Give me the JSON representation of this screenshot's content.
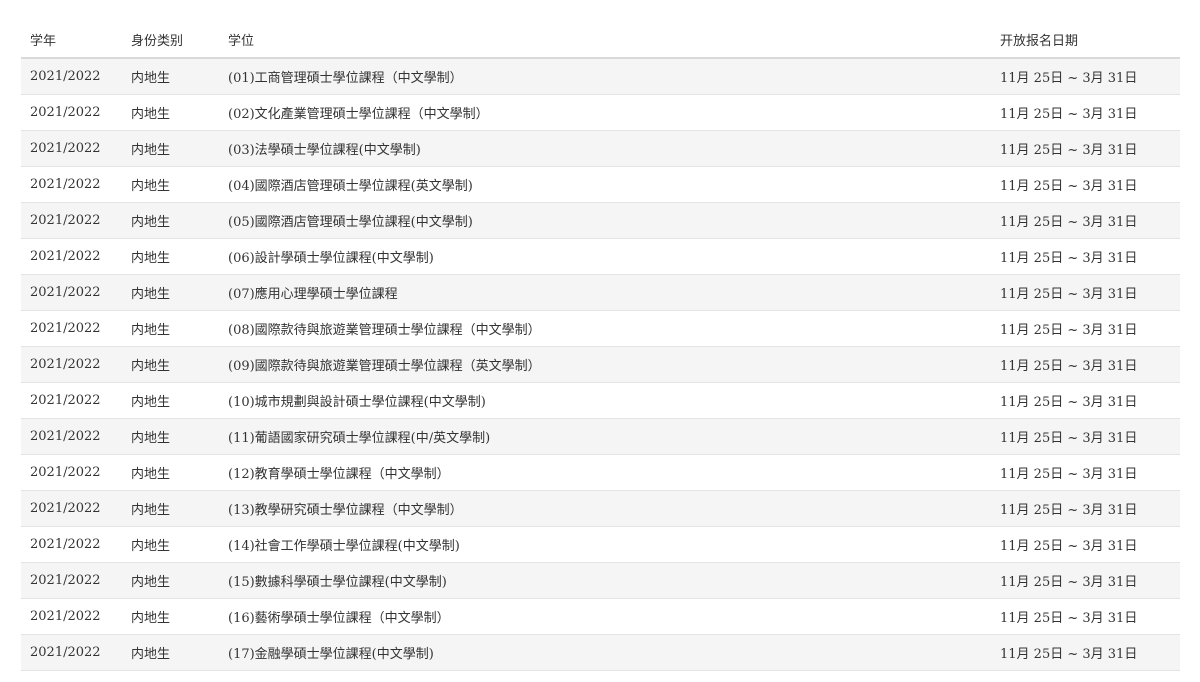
{
  "table": {
    "headers": {
      "year": "学年",
      "type": "身份类别",
      "degree": "学位",
      "date": "开放报名日期"
    },
    "rows": [
      {
        "year": "2021/2022",
        "type": "内地生",
        "degree": "(01)工商管理碩士學位課程（中文學制）",
        "date": "11月 25日 ~ 3月 31日"
      },
      {
        "year": "2021/2022",
        "type": "内地生",
        "degree": "(02)文化產業管理碩士學位課程（中文學制）",
        "date": "11月 25日 ~ 3月 31日"
      },
      {
        "year": "2021/2022",
        "type": "内地生",
        "degree": "(03)法學碩士學位課程(中文學制)",
        "date": "11月 25日 ~ 3月 31日"
      },
      {
        "year": "2021/2022",
        "type": "内地生",
        "degree": "(04)國際酒店管理碩士學位課程(英文學制)",
        "date": "11月 25日 ~ 3月 31日"
      },
      {
        "year": "2021/2022",
        "type": "内地生",
        "degree": "(05)國際酒店管理碩士學位課程(中文學制)",
        "date": "11月 25日 ~ 3月 31日"
      },
      {
        "year": "2021/2022",
        "type": "内地生",
        "degree": "(06)設計學碩士學位課程(中文學制)",
        "date": "11月 25日 ~ 3月 31日"
      },
      {
        "year": "2021/2022",
        "type": "内地生",
        "degree": "(07)應用心理學碩士學位課程",
        "date": "11月 25日 ~ 3月 31日"
      },
      {
        "year": "2021/2022",
        "type": "内地生",
        "degree": "(08)國際款待與旅遊業管理碩士學位課程（中文學制）",
        "date": "11月 25日 ~ 3月 31日"
      },
      {
        "year": "2021/2022",
        "type": "内地生",
        "degree": "(09)國際款待與旅遊業管理碩士學位課程（英文學制）",
        "date": "11月 25日 ~ 3月 31日"
      },
      {
        "year": "2021/2022",
        "type": "内地生",
        "degree": "(10)城市規劃與設計碩士學位課程(中文學制)",
        "date": "11月 25日 ~ 3月 31日"
      },
      {
        "year": "2021/2022",
        "type": "内地生",
        "degree": "(11)葡語國家研究碩士學位課程(中/英文學制)",
        "date": "11月 25日 ~ 3月 31日"
      },
      {
        "year": "2021/2022",
        "type": "内地生",
        "degree": "(12)教育學碩士學位課程（中文學制）",
        "date": "11月 25日 ~ 3月 31日"
      },
      {
        "year": "2021/2022",
        "type": "内地生",
        "degree": "(13)教學研究碩士學位課程（中文學制）",
        "date": "11月 25日 ~ 3月 31日"
      },
      {
        "year": "2021/2022",
        "type": "内地生",
        "degree": "(14)社會工作學碩士學位課程(中文學制)",
        "date": "11月 25日 ~ 3月 31日"
      },
      {
        "year": "2021/2022",
        "type": "内地生",
        "degree": "(15)數據科學碩士學位課程(中文學制)",
        "date": "11月 25日 ~ 3月 31日"
      },
      {
        "year": "2021/2022",
        "type": "内地生",
        "degree": "(16)藝術學碩士學位課程（中文學制）",
        "date": "11月 25日 ~ 3月 31日"
      },
      {
        "year": "2021/2022",
        "type": "内地生",
        "degree": "(17)金融學碩士學位課程(中文學制)",
        "date": "11月 25日 ~ 3月 31日"
      }
    ]
  }
}
